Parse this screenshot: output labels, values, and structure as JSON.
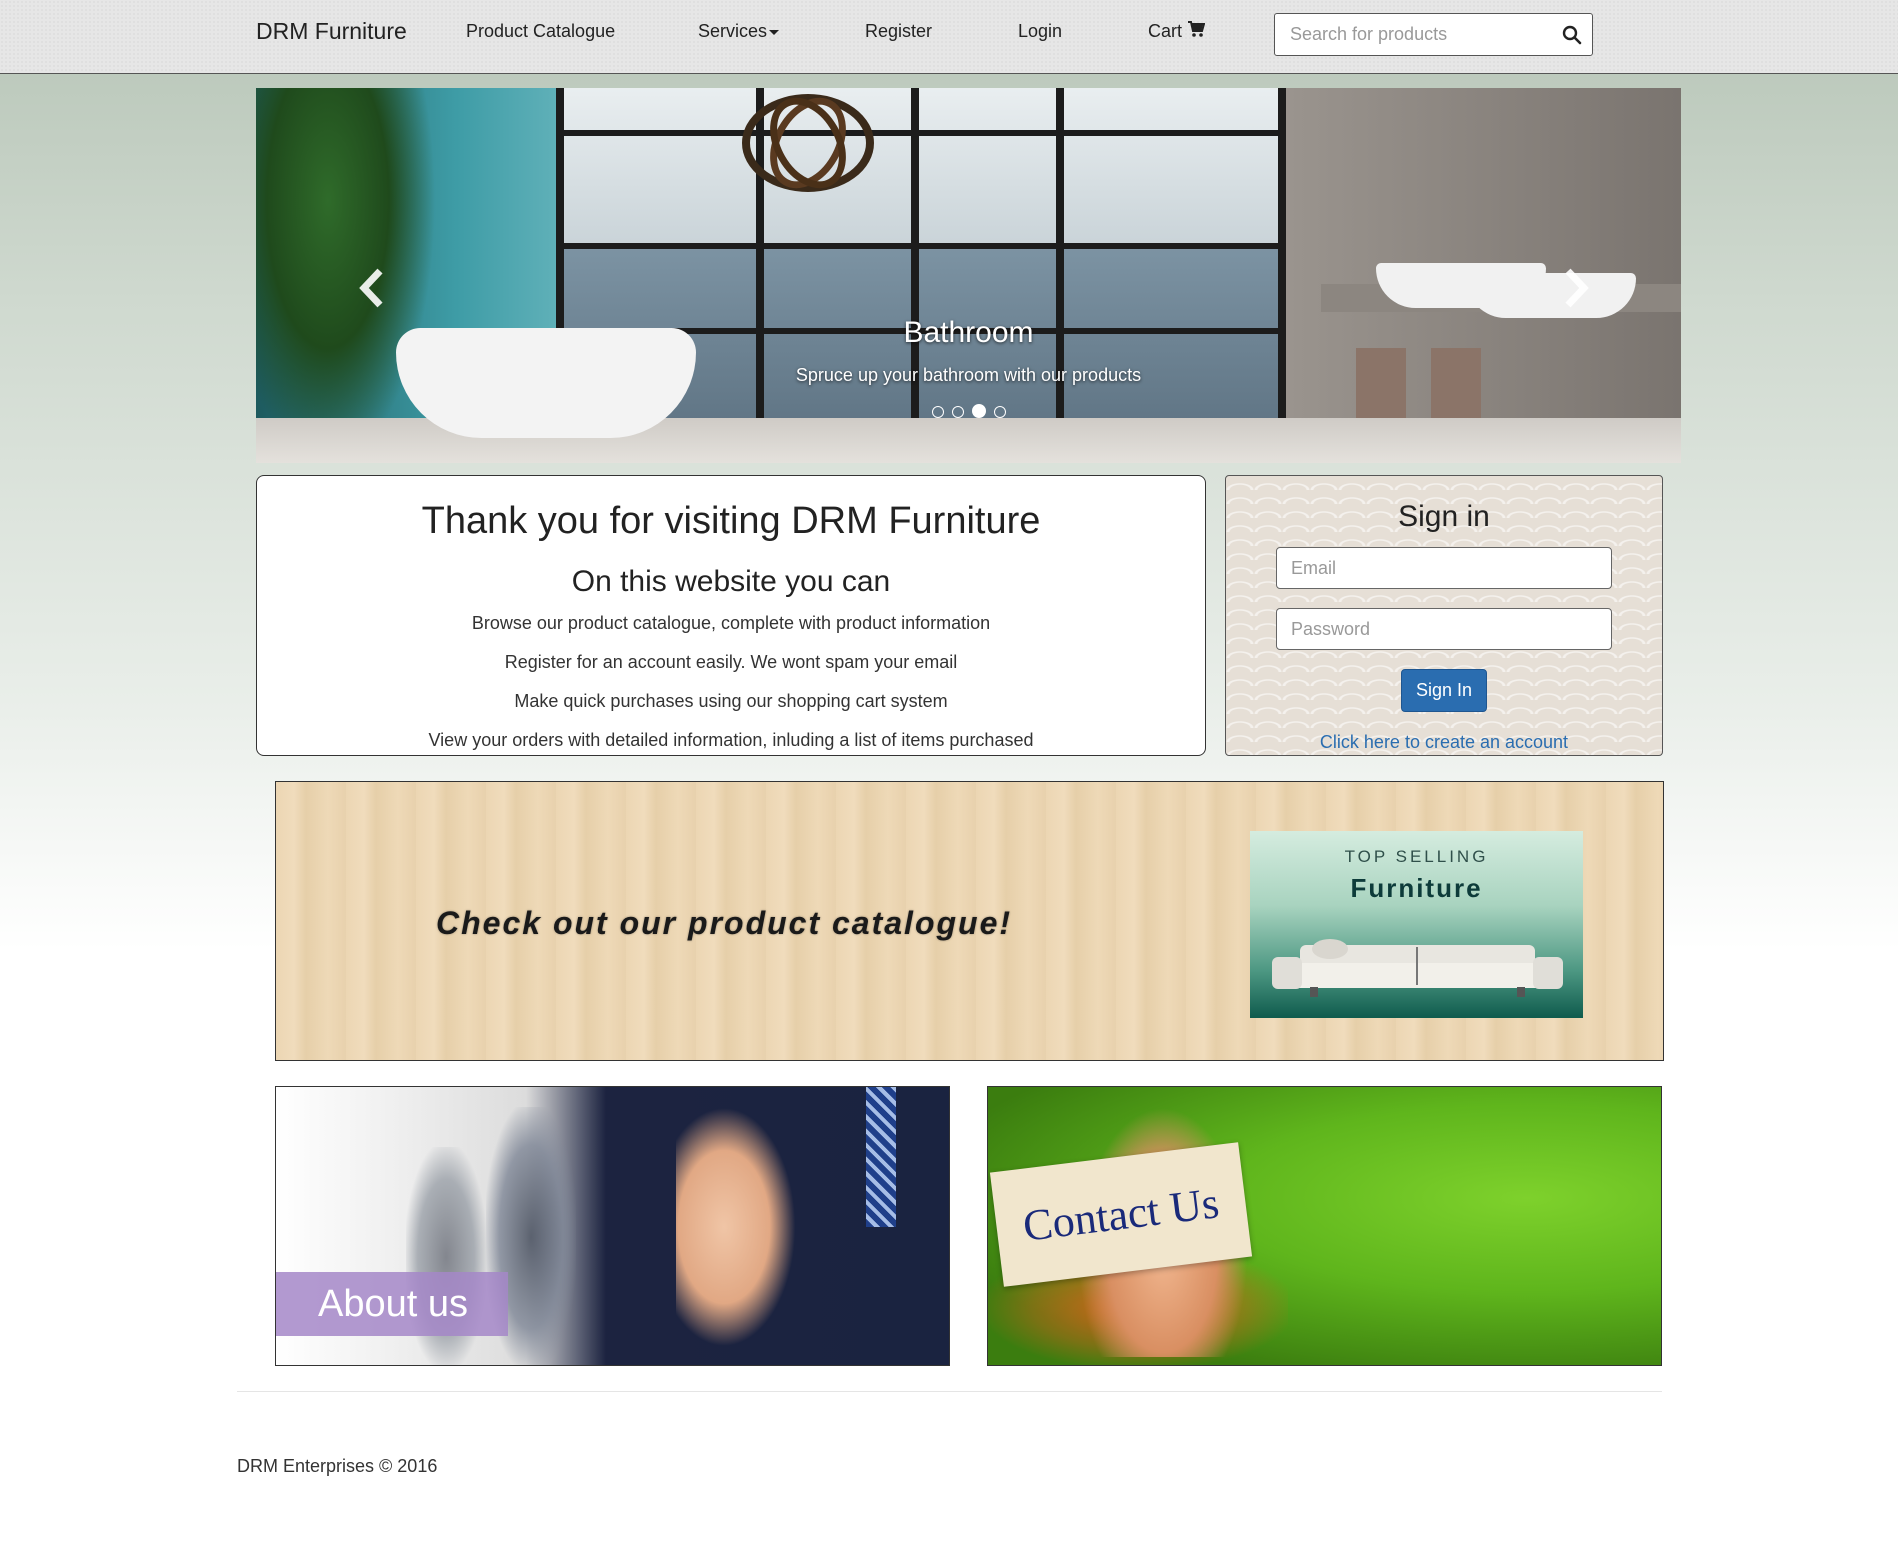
{
  "navbar": {
    "brand": "DRM Furniture",
    "links": {
      "catalogue": "Product Catalogue",
      "services": "Services",
      "register": "Register",
      "login": "Login",
      "cart": "Cart"
    },
    "search_placeholder": "Search for products"
  },
  "carousel": {
    "title": "Bathroom",
    "subtitle": "Spruce up your bathroom with our products",
    "indicator_count": 4,
    "active_index": 2
  },
  "welcome": {
    "heading": "Thank you for visiting DRM Furniture",
    "subheading": "On this website you can",
    "items": [
      "Browse our product catalogue, complete with product information",
      "Register for an account easily. We wont spam your email",
      "Make quick purchases using our shopping cart system",
      "View your orders with detailed information, inluding a list of items purchased"
    ]
  },
  "signin": {
    "title": "Sign in",
    "email_placeholder": "Email",
    "password_placeholder": "Password",
    "button": "Sign In",
    "create_link": "Click here to create an account"
  },
  "banner": {
    "text": "Check out our product catalogue!",
    "top_selling_line1": "TOP SELLING",
    "top_selling_line2": "Furniture"
  },
  "tiles": {
    "about": "About us",
    "contact": "Contact Us"
  },
  "footer": {
    "text": "DRM Enterprises © 2016"
  },
  "colors": {
    "primary_button": "#2a6db0",
    "link": "#2a6db0"
  }
}
